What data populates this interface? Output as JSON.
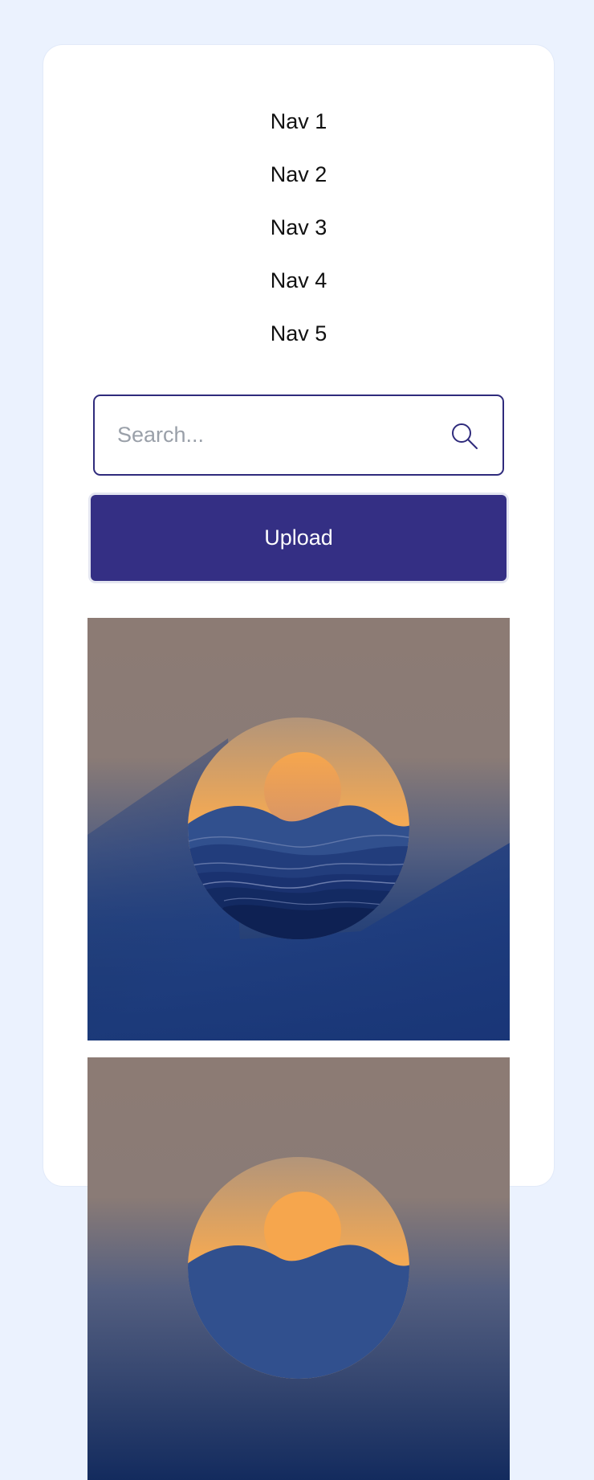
{
  "nav": {
    "items": [
      {
        "label": "Nav 1"
      },
      {
        "label": "Nav 2"
      },
      {
        "label": "Nav 3"
      },
      {
        "label": "Nav 4"
      },
      {
        "label": "Nav 5"
      }
    ]
  },
  "search": {
    "placeholder": "Search...",
    "value": "",
    "icon": "search-icon"
  },
  "upload": {
    "label": "Upload"
  },
  "gallery": {
    "images": [
      {
        "subject": "sunset-over-waves-illustration"
      },
      {
        "subject": "sunset-over-waves-illustration"
      }
    ]
  },
  "colors": {
    "background": "#ebf2fe",
    "card": "#ffffff",
    "accent": "#342f84",
    "search_border": "#2f2b7c"
  }
}
